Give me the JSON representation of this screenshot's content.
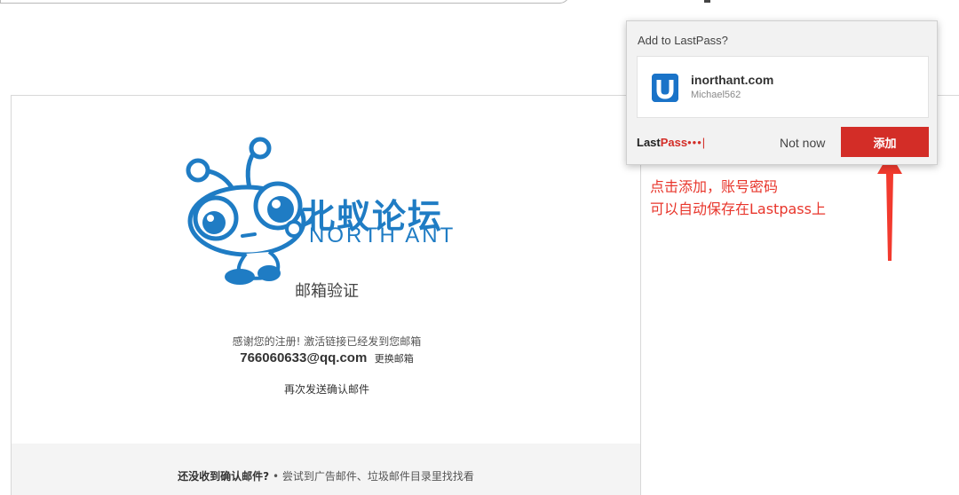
{
  "browser": {},
  "page": {
    "logo_cn": "北蚁论坛",
    "logo_en": "NORTH ANT",
    "heading": "邮箱验证",
    "info": "感谢您的注册! 激活链接已经发到您邮箱",
    "email": "766060633@qq.com",
    "change_email": "更换邮箱",
    "resend": "再次发送确认邮件",
    "tip_bold": "还没收到确认邮件?",
    "tip_rest": " • 尝试到广告邮件、垃圾邮件目录里找找看"
  },
  "annotation": {
    "line1": "点击添加，账号密码",
    "line2": "可以自动保存在Lastpass上",
    "color": "#e8352b"
  },
  "lastpass": {
    "title": "Add to LastPass?",
    "site_name": "inorthant.com",
    "username": "Michael562",
    "brand_last": "Last",
    "brand_pass": "Pass",
    "brand_dots": "•••|",
    "not_now": "Not now",
    "add_button": "添加",
    "accent": "#d32d27",
    "site_icon": "u-logo-icon"
  },
  "colors": {
    "brand_blue": "#1f7cc4",
    "tip_background": "#f4f4f4"
  }
}
